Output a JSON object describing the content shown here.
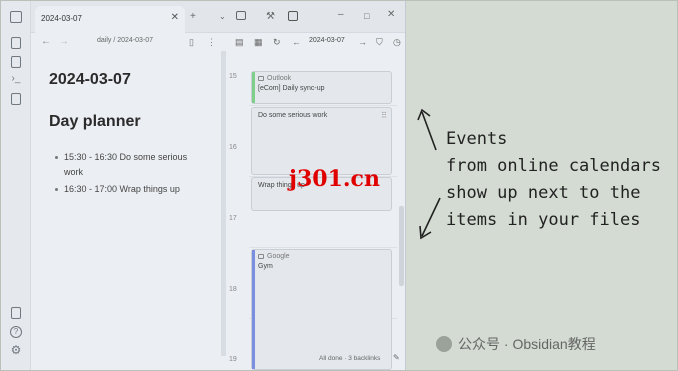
{
  "tab": {
    "title": "2024-03-07"
  },
  "breadcrumb": {
    "folder": "daily",
    "file": "2024-03-07"
  },
  "note": {
    "title": "2024-03-07",
    "section": "Day planner",
    "items": [
      {
        "line1": "15:30 - 16:30 Do some serious",
        "line2": "work"
      },
      {
        "line1": "16:30 - 17:00 Wrap things up",
        "line2": ""
      }
    ]
  },
  "timeline": {
    "date": "2024-03-07",
    "hours": [
      "15",
      "16",
      "17",
      "18",
      "19"
    ],
    "events": [
      {
        "source": "Outlook",
        "title": "[eCom] Daily sync-up",
        "accent": "#7fcf8a"
      },
      {
        "source": "",
        "title": "Do some serious work",
        "accent": ""
      },
      {
        "source": "",
        "title": "Wrap things up",
        "accent": ""
      },
      {
        "source": "Google",
        "title": "Gym",
        "accent": "#7b8fe0"
      }
    ],
    "status": "All done · 3 backlinks"
  },
  "annotation": {
    "lines": [
      "Events",
      "from online calendars",
      "show up next to the",
      "items in your files"
    ]
  },
  "watermark": "j301.cn",
  "brand": "公众号 · Obsidian教程",
  "icons": {
    "ribbon": [
      "sidebar-toggle-icon",
      "folder-icon",
      "calendar-icon",
      "terminal-icon",
      "calendar-grid-icon",
      "publish-icon",
      "help-icon",
      "settings-icon"
    ]
  }
}
